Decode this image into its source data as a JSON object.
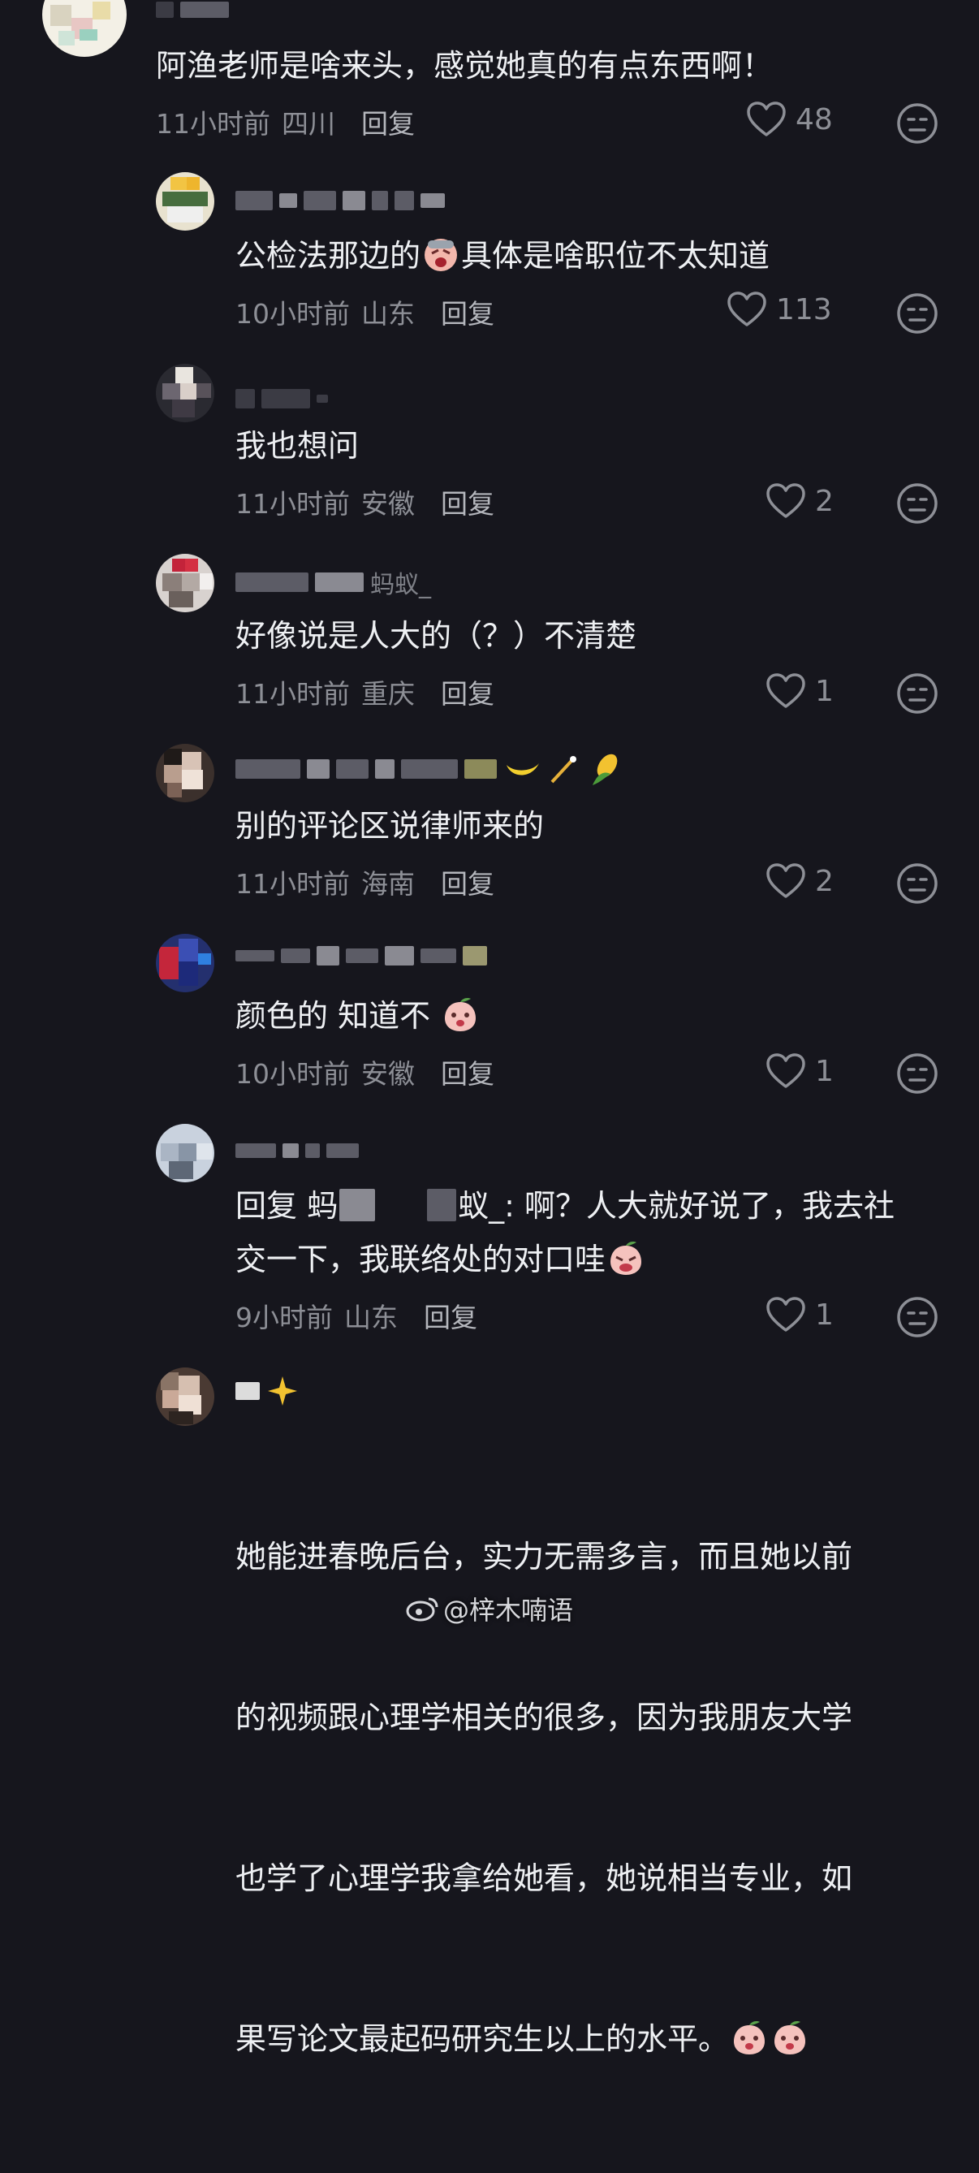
{
  "comments": [
    {
      "text": "阿渔老师是啥来头，感觉她真的有点东西啊！",
      "time": "11小时前",
      "region": "四川",
      "reply": "回复",
      "likes": "48"
    },
    {
      "text": "公检法那边的",
      "text_after_emoji": "具体是啥职位不太知道",
      "time": "10小时前",
      "region": "山东",
      "reply": "回复",
      "likes": "113"
    },
    {
      "text": "我也想问",
      "time": "11小时前",
      "region": "安徽",
      "reply": "回复",
      "likes": "2"
    },
    {
      "username_visible": "蚂蚁_",
      "text": "好像说是人大的（？）不清楚",
      "time": "11小时前",
      "region": "重庆",
      "reply": "回复",
      "likes": "1"
    },
    {
      "text": "别的评论区说律师来的",
      "time": "11小时前",
      "region": "海南",
      "reply": "回复",
      "likes": "2"
    },
    {
      "text": "颜色的 知道不",
      "time": "10小时前",
      "region": "安徽",
      "reply": "回复",
      "likes": "1"
    },
    {
      "text_line1_a": "回复 蚂",
      "text_line1_b": "蚁_: 啊？人大就好说了，我去社",
      "text_line2": "交一下，我联络处的对口哇",
      "time": "9小时前",
      "region": "山东",
      "reply": "回复",
      "likes": "1"
    },
    {
      "lines": [
        "她能进春晚后台，实力无需多言，而且她以前",
        "的视频跟心理学相关的很多，因为我朋友大学",
        "也学了心理学我拿给她看，她说相当专业，如",
        "果写论文最起码研究生以上的水平。"
      ]
    }
  ],
  "watermark": "@梓木喃语",
  "colors": {
    "background": "#16161d",
    "text": "#eef0f3",
    "meta": "#8d8f96"
  },
  "icons": {
    "like": "heart-outline-icon",
    "dislike": "neutral-face-icon"
  }
}
